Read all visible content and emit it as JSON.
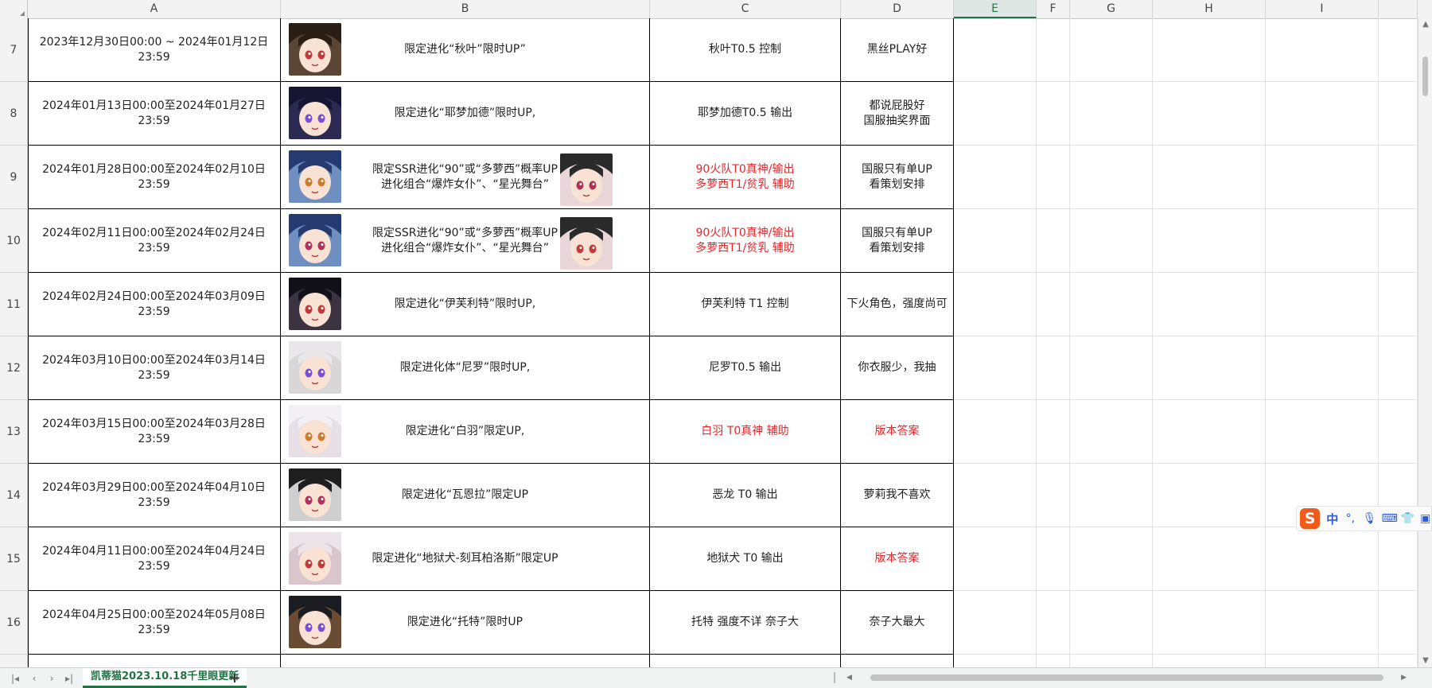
{
  "columns": [
    {
      "letter": "A"
    },
    {
      "letter": "B"
    },
    {
      "letter": "C"
    },
    {
      "letter": "D"
    },
    {
      "letter": "E",
      "selected": true
    },
    {
      "letter": "F"
    },
    {
      "letter": "G"
    },
    {
      "letter": "H"
    },
    {
      "letter": "I"
    }
  ],
  "rows": [
    {
      "num": "7",
      "date": "2023年12月30日00:00 ~ 2024年01月12日23:59",
      "event_lines": [
        "限定进化“秋叶”限时UP”"
      ],
      "tier_lines": [
        "秋叶T0.5 控制"
      ],
      "tier_red": false,
      "note_lines": [
        "黑丝PLAY好"
      ],
      "note_red": false,
      "portrait_color": "#5b4636",
      "portrait_hair": "#2a1d14"
    },
    {
      "num": "8",
      "date": "2024年01月13日00:00至2024年01月27日23:59",
      "event_lines": [
        "限定进化“耶梦加德”限时UP,"
      ],
      "tier_lines": [
        "耶梦加德T0.5 输出"
      ],
      "tier_red": false,
      "note_lines": [
        "都说屁股好",
        "国服抽奖界面"
      ],
      "note_red": false,
      "portrait_color": "#2c2a52",
      "portrait_hair": "#151533"
    },
    {
      "num": "9",
      "date": "2024年01月28日00:00至2024年02月10日23:59",
      "event_lines": [
        "限定SSR进化“90”或“多萝西”概率UP",
        "进化组合“爆炸女仆”、“星光舞台”"
      ],
      "tier_lines": [
        "90火队T0真神/输出",
        "多萝西T1/贫乳 辅助"
      ],
      "tier_red": true,
      "note_lines": [
        "国服只有单UP",
        "看策划安排"
      ],
      "note_red": false,
      "portrait_color": "#6f8fc0",
      "portrait_hair": "#263a72",
      "second_portrait": true
    },
    {
      "num": "10",
      "date": "2024年02月11日00:00至2024年02月24日23:59",
      "event_lines": [
        "限定SSR进化“90”或“多萝西”概率UP",
        "进化组合“爆炸女仆”、“星光舞台”"
      ],
      "tier_lines": [
        "90火队T0真神/输出",
        "多萝西T1/贫乳 辅助"
      ],
      "tier_red": true,
      "note_lines": [
        "国服只有单UP",
        "看策划安排"
      ],
      "note_red": false,
      "portrait_color": "#6f8fc0",
      "portrait_hair": "#263a72",
      "second_portrait": true
    },
    {
      "num": "11",
      "date": "2024年02月24日00:00至2024年03月09日23:59",
      "event_lines": [
        "限定进化“伊芙利特”限时UP,"
      ],
      "tier_lines": [
        "伊芙利特 T1 控制"
      ],
      "tier_red": false,
      "note_lines": [
        "下火角色，强度尚可"
      ],
      "note_red": false,
      "portrait_color": "#3b3340",
      "portrait_hair": "#121018"
    },
    {
      "num": "12",
      "date": "2024年03月10日00:00至2024年03月14日23:59",
      "event_lines": [
        "限定进化体“尼罗”限时UP,"
      ],
      "tier_lines": [
        "尼罗T0.5 输出"
      ],
      "tier_red": false,
      "note_lines": [
        "你衣服少，我抽"
      ],
      "note_red": false,
      "portrait_color": "#d9d6d8",
      "portrait_hair": "#e9e7ea"
    },
    {
      "num": "13",
      "date": "2024年03月15日00:00至2024年03月28日23:59",
      "event_lines": [
        "限定进化“白羽”限定UP,"
      ],
      "tier_lines": [
        "白羽 T0真神 辅助"
      ],
      "tier_red": true,
      "note_lines": [
        "版本答案"
      ],
      "note_red": true,
      "portrait_color": "#e6dfe6",
      "portrait_hair": "#f3f0f5"
    },
    {
      "num": "14",
      "date": "2024年03月29日00:00至2024年04月10日23:59",
      "event_lines": [
        "限定进化“瓦恩拉”限定UP"
      ],
      "tier_lines": [
        "恶龙 T0 输出"
      ],
      "tier_red": false,
      "note_lines": [
        "萝莉我不喜欢"
      ],
      "note_red": false,
      "portrait_color": "#cfcfcf",
      "portrait_hair": "#1e1e1e"
    },
    {
      "num": "15",
      "date": "2024年04月11日00:00至2024年04月24日23:59",
      "event_lines": [
        "限定进化“地狱犬-刻耳柏洛斯”限定UP"
      ],
      "tier_lines": [
        "地狱犬 T0 输出"
      ],
      "tier_red": false,
      "note_lines": [
        "版本答案"
      ],
      "note_red": true,
      "portrait_color": "#d8c6cc",
      "portrait_hair": "#ece4e8"
    },
    {
      "num": "16",
      "date": "2024年04月25日00:00至2024年05月08日23:59",
      "event_lines": [
        "限定进化“托特”限时UP"
      ],
      "tier_lines": [
        "托特 强度不详 奈子大"
      ],
      "tier_red": false,
      "note_lines": [
        "奈子大最大"
      ],
      "note_red": false,
      "portrait_color": "#6a4b33",
      "portrait_hair": "#1b1b22"
    }
  ],
  "sheet_tab_label": "凯蒂猫2023.10.18千里眼更新",
  "add_sheet_label": "+",
  "ime": {
    "logo": "S",
    "mode": "中"
  },
  "colors": {
    "accent": "#217346",
    "red_text": "#e8262b",
    "grid_header_bg": "#f3f3f3"
  }
}
